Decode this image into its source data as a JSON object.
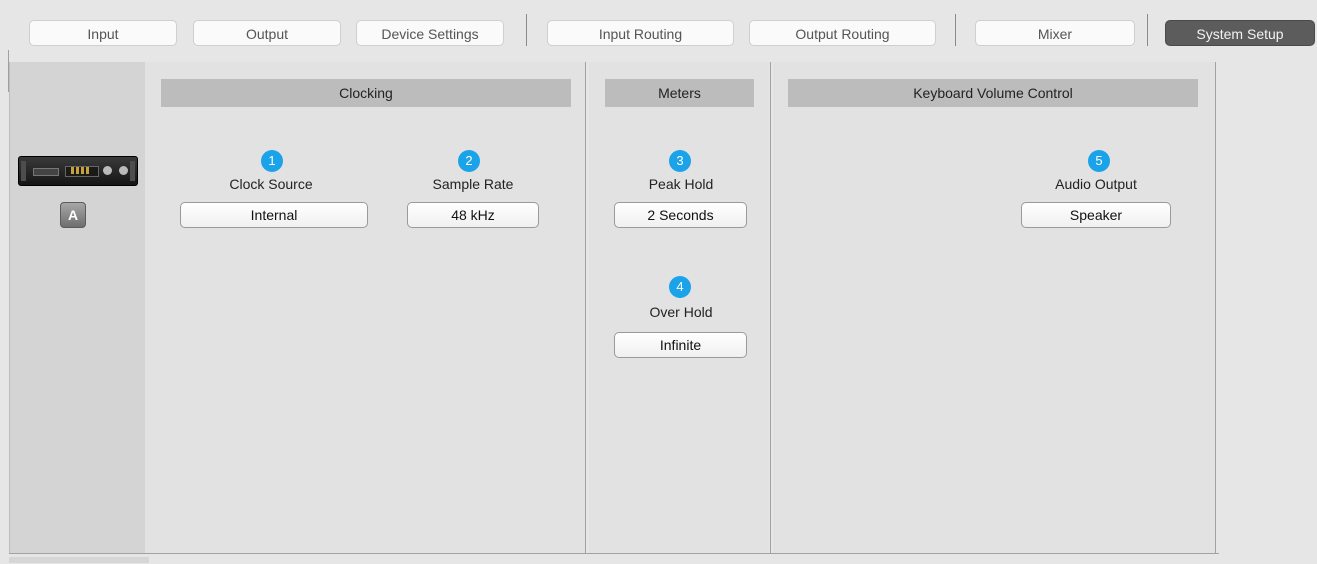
{
  "tabs": {
    "input": "Input",
    "output": "Output",
    "device_settings": "Device Settings",
    "input_routing": "Input Routing",
    "output_routing": "Output Routing",
    "mixer": "Mixer",
    "system_setup": "System Setup",
    "active": "System Setup"
  },
  "sidebar": {
    "device_icon": "audio-interface-icon",
    "unit_label": "A"
  },
  "clocking": {
    "title": "Clocking",
    "clock_source": {
      "badge": "1",
      "label": "Clock Source",
      "value": "Internal"
    },
    "sample_rate": {
      "badge": "2",
      "label": "Sample Rate",
      "value": "48 kHz"
    }
  },
  "meters": {
    "title": "Meters",
    "peak_hold": {
      "badge": "3",
      "label": "Peak Hold",
      "value": "2 Seconds"
    },
    "over_hold": {
      "badge": "4",
      "label": "Over Hold",
      "value": "Infinite"
    }
  },
  "keyboard_volume": {
    "title": "Keyboard Volume Control",
    "audio_output": {
      "badge": "5",
      "label": "Audio Output",
      "value": "Speaker"
    }
  },
  "colors": {
    "badge": "#1aa3e8",
    "active_tab": "#5c5c5c",
    "section_header": "#bcbcbc"
  }
}
